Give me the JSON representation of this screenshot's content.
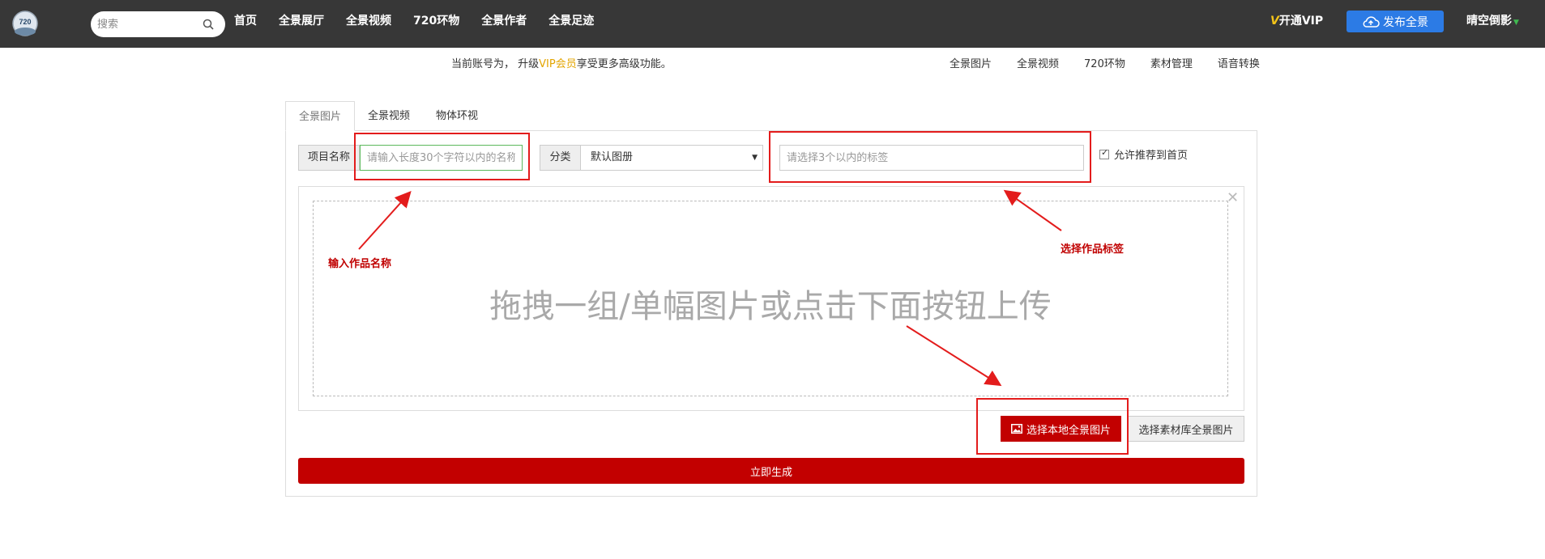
{
  "header": {
    "logo_text": "720",
    "search": {
      "placeholder": "搜索"
    },
    "nav": [
      "首页",
      "全景展厅",
      "全景视频",
      "720环物",
      "全景作者",
      "全景足迹"
    ],
    "vip_label": "开通VIP",
    "publish_label": "发布全景",
    "user_name": "晴空倒影"
  },
  "notice": {
    "prefix": "当前账号为，  升级",
    "highlight": "VIP会员",
    "suffix": "享受更多高级功能。"
  },
  "subnav": [
    "全景图片",
    "全景视频",
    "720环物",
    "素材管理",
    "语音转换"
  ],
  "tabs": [
    "全景图片",
    "全景视频",
    "物体环视"
  ],
  "form": {
    "name_label": "项目名称",
    "name_placeholder": "请输入长度30个字符以内的名称",
    "category_label": "分类",
    "category_value": "默认图册",
    "tag_placeholder": "请选择3个以内的标签",
    "recommend_label": "允许推荐到首页"
  },
  "dropzone": {
    "text": "拖拽一组/单幅图片或点击下面按钮上传"
  },
  "buttons": {
    "local": "选择本地全景图片",
    "library": "选择素材库全景图片",
    "generate": "立即生成"
  },
  "annotations": {
    "name": "输入作品名称",
    "tags": "选择作品标签"
  },
  "colors": {
    "topbar": "#373737",
    "accent_red": "#c20000",
    "publish_blue": "#2c7be5",
    "vip_gold": "#e3a500"
  }
}
